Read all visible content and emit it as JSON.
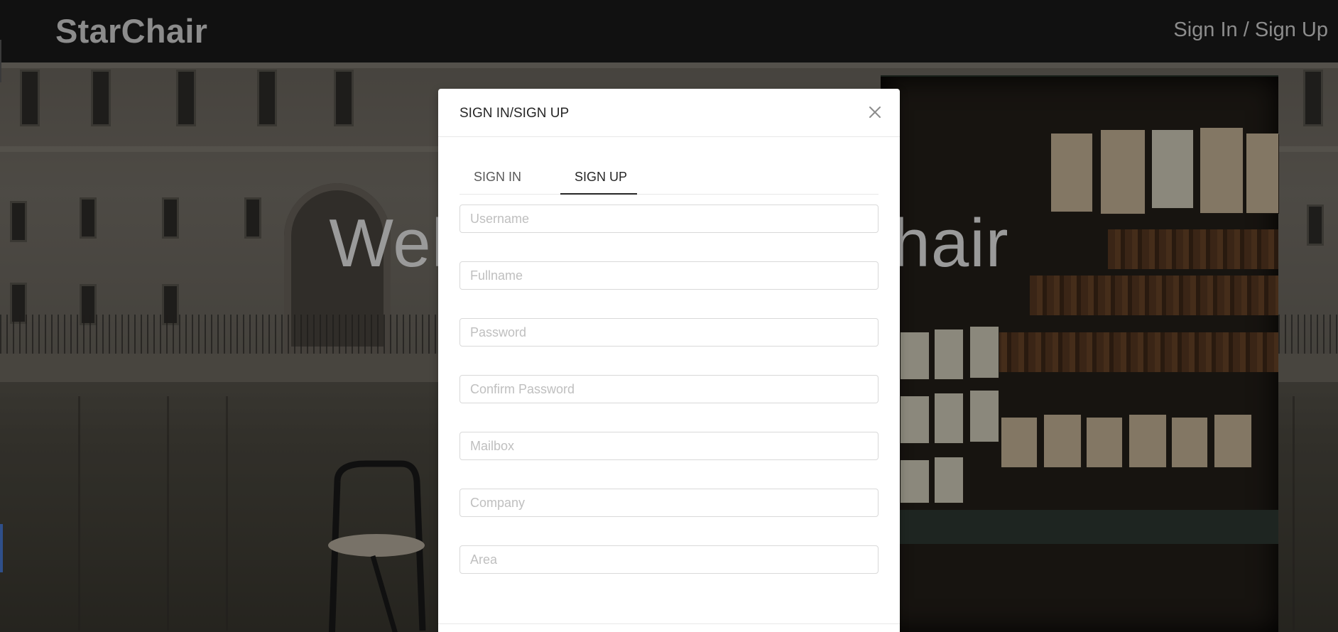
{
  "header": {
    "brand": "StarChair",
    "auth_link": "Sign In / Sign Up"
  },
  "hero": {
    "title": "Welcome to StarChair"
  },
  "modal": {
    "title": "SIGN IN/SIGN UP",
    "close_icon": "close-icon",
    "tabs": [
      {
        "label": "SIGN IN",
        "active": false
      },
      {
        "label": "SIGN UP",
        "active": true
      }
    ],
    "fields": [
      {
        "placeholder": "Username",
        "value": ""
      },
      {
        "placeholder": "Fullname",
        "value": ""
      },
      {
        "placeholder": "Password",
        "value": ""
      },
      {
        "placeholder": "Confirm Password",
        "value": ""
      },
      {
        "placeholder": "Mailbox",
        "value": ""
      },
      {
        "placeholder": "Company",
        "value": ""
      },
      {
        "placeholder": "Area",
        "value": ""
      }
    ]
  },
  "colors": {
    "header_bg": "#111111",
    "brand_text": "#8c8c8c",
    "modal_bg": "#ffffff",
    "active_tab": "#262626",
    "input_border": "#d9d9d9",
    "placeholder": "#bfbfbf"
  }
}
